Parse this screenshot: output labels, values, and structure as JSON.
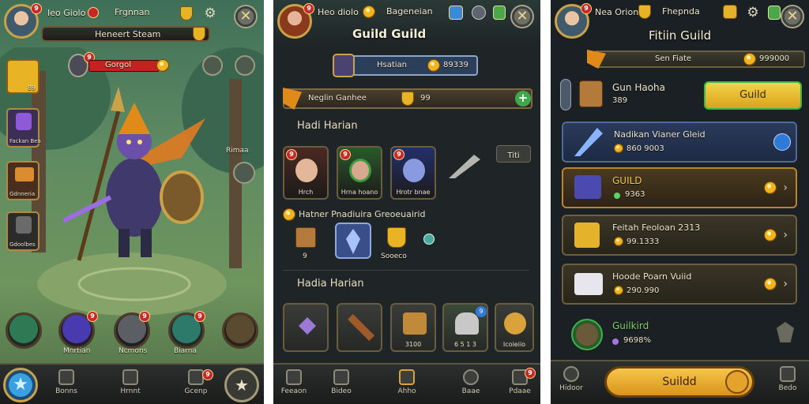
{
  "panel1": {
    "header_name": "Ieo Giolo",
    "header_label": "Frgnnan",
    "title_bar": "Heneert Steam",
    "avatar_badge": "9",
    "event_badge": "9",
    "event_label": "Gorgol",
    "side_items": [
      {
        "label": "89",
        "icon": "gold-chest-icon"
      },
      {
        "label": "Fackan Bea",
        "icon": "purple-helm-icon"
      },
      {
        "label": "Gdnneria",
        "icon": "treasure-chest-icon"
      },
      {
        "label": "Gdoolbes",
        "icon": "dark-knight-icon"
      }
    ],
    "right_label": "Rimaa",
    "round_buttons": [
      {
        "label": "",
        "badge": ""
      },
      {
        "label": "Mnrtian",
        "badge": "9"
      },
      {
        "label": "Ncmons",
        "badge": "9"
      },
      {
        "label": "Biarna",
        "badge": "9"
      }
    ],
    "nav": [
      {
        "label": "",
        "icon": "star-icon"
      },
      {
        "label": "Bonns",
        "icon": "sword-icon"
      },
      {
        "label": "Hrnnt",
        "icon": "book-icon"
      },
      {
        "label": "Gcenp",
        "icon": "clock-icon",
        "badge": "9"
      },
      {
        "label": "",
        "icon": "star-icon"
      }
    ]
  },
  "panel2": {
    "header_name": "Heo diolo",
    "header_label": "Bageneian",
    "title": "Guild Guild",
    "sub_label": "Hsatian",
    "sub_value": "89339",
    "guild_row_label": "Neglin Ganhee",
    "guild_row_value": "99",
    "section1_title": "Hadi Harian",
    "heroes": [
      {
        "label": "Hrch",
        "badge": "9"
      },
      {
        "label": "Hrna hoano",
        "badge": "9"
      },
      {
        "label": "Hrotr bnae",
        "badge": "9"
      }
    ],
    "small_button": "Titi",
    "section2_title": "Hatner Pnadiuira Greoeuairid",
    "rewards": [
      {
        "label": "9",
        "icon": "crate-icon"
      },
      {
        "label": "",
        "icon": "crystal-icon"
      },
      {
        "label": "Sooeco",
        "icon": "shield-icon"
      },
      {
        "label": "",
        "icon": "potion-icon"
      }
    ],
    "section3_title": "Hadia Harian",
    "items": [
      {
        "label": "",
        "icon": "arrow-icon"
      },
      {
        "label": "",
        "icon": "crossbow-icon"
      },
      {
        "label": "3100",
        "icon": "gauntlet-icon"
      },
      {
        "label": "6 5 1 3",
        "icon": "helmet-icon",
        "badge": "9"
      },
      {
        "label": "Icoieiio",
        "icon": "horn-icon"
      }
    ],
    "nav": [
      {
        "label": "Feeaon",
        "icon": "scroll-icon"
      },
      {
        "label": "Bideo",
        "icon": "chest-icon"
      },
      {
        "label": "Ahho",
        "icon": "book-icon"
      },
      {
        "label": "Baae",
        "icon": "gear-icon"
      },
      {
        "label": "Pdaae",
        "icon": "shop-icon",
        "badge": "9"
      }
    ]
  },
  "panel3": {
    "header_name": "Nea Orion",
    "header_label": "Fhepnda",
    "title": "Fitiin Guild",
    "banner_label": "Sen Fiate",
    "banner_value": "999000",
    "info_name": "Gun Haoha",
    "info_value": "389",
    "guild_button": "Guild",
    "cards": [
      {
        "title": "Nadikan Vianer Gleid",
        "value": "860 9003"
      },
      {
        "title": "GUILD",
        "value": "9363"
      },
      {
        "title": "Feitah Feoloan 2313",
        "value": "99.1333"
      },
      {
        "title": "Hoode Poarn Vuiid",
        "value": "290.990"
      }
    ],
    "footer_title": "Guilkird",
    "footer_value": "9698%",
    "main_button": "Suildd",
    "nav": [
      {
        "label": "Hidoor",
        "icon": "cauldron-icon"
      },
      {
        "label": "",
        "icon": "gear-icon"
      },
      {
        "label": "Bedo",
        "icon": "chest-icon"
      }
    ]
  }
}
